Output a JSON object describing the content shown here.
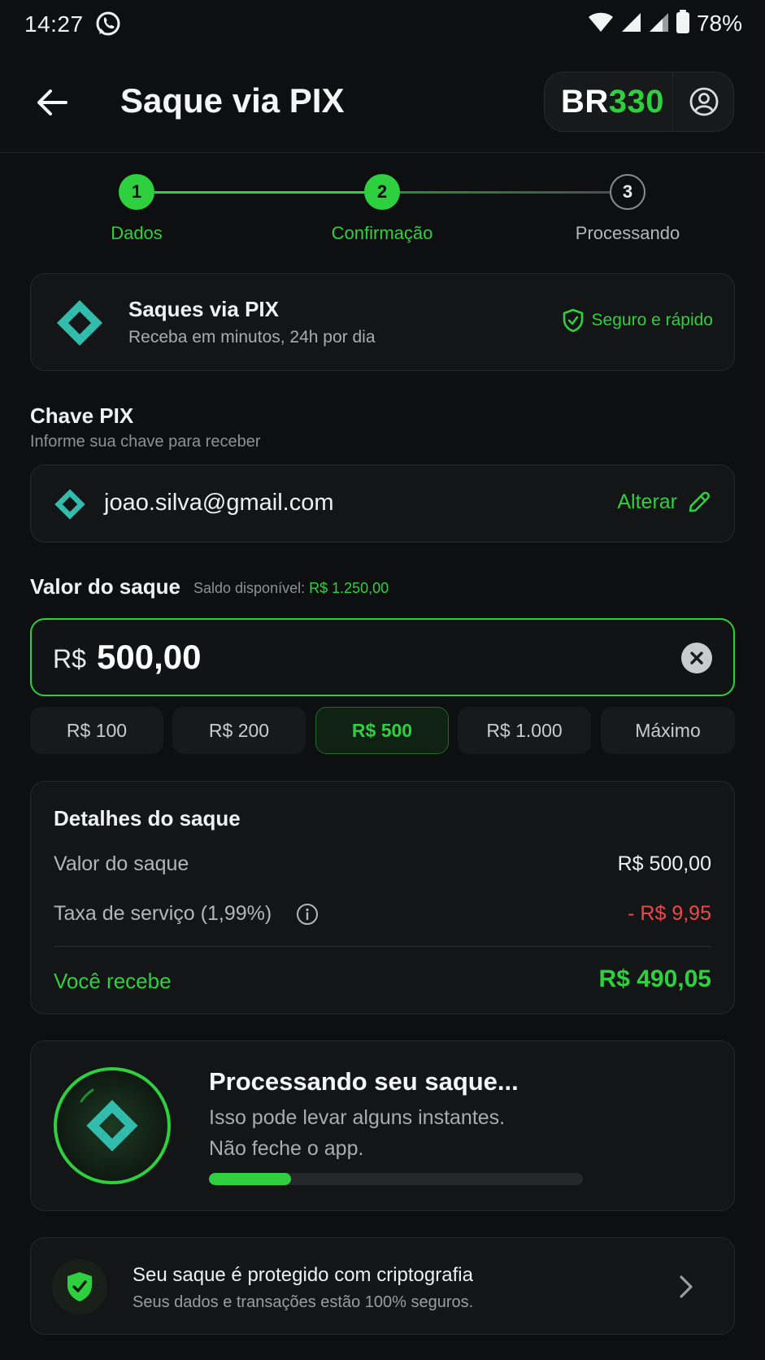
{
  "status_bar": {
    "time": "14:27",
    "battery": "78%",
    "icons": [
      "whatsapp-icon",
      "wifi-icon",
      "signal-icon",
      "signal-icon",
      "battery-icon"
    ]
  },
  "header": {
    "title": "Saque via PIX",
    "brand_prefix": "BR",
    "brand_suffix": "330"
  },
  "stepper": {
    "steps": [
      {
        "number": "1",
        "label": "Dados",
        "state": "done"
      },
      {
        "number": "2",
        "label": "Confirmação",
        "state": "current"
      },
      {
        "number": "3",
        "label": "Processando",
        "state": "pending"
      }
    ]
  },
  "pix_info": {
    "title": "Saques via PIX",
    "subtitle": "Receba em minutos, 24h por dia",
    "badge": "Seguro e rápido"
  },
  "pix_key": {
    "title": "Chave PIX",
    "subtitle": "Informe sua chave para receber",
    "value": "joao.silva@gmail.com",
    "change_label": "Alterar"
  },
  "amount": {
    "title": "Valor do saque",
    "balance_label": "Saldo disponível:",
    "balance_value": "R$ 1.250,00",
    "currency": "R$",
    "value": "500,00",
    "quick_options": [
      {
        "label": "R$ 100",
        "active": false
      },
      {
        "label": "R$ 200",
        "active": false
      },
      {
        "label": "R$ 500",
        "active": true
      },
      {
        "label": "R$ 1.000",
        "active": false
      },
      {
        "label": "Máximo",
        "active": false
      }
    ]
  },
  "details": {
    "title": "Detalhes do saque",
    "withdraw_label": "Valor do saque",
    "withdraw_value": "R$ 500,00",
    "fee_label": "Taxa de serviço (1,99%)",
    "fee_value": "- R$ 9,95",
    "receive_label": "Você recebe",
    "receive_value": "R$ 490,05"
  },
  "processing": {
    "title": "Processando seu saque...",
    "line1": "Isso pode levar alguns instantes.",
    "line2": "Não feche o app.",
    "progress": 0.22
  },
  "security": {
    "title": "Seu saque é protegido com criptografia",
    "subtitle": "Seus dados e transações estão 100% seguros."
  },
  "colors": {
    "accent": "#2fd03f",
    "background": "#0e0f10",
    "card": "#141517",
    "pix_teal": "#32bcad",
    "negative": "#f04848"
  }
}
